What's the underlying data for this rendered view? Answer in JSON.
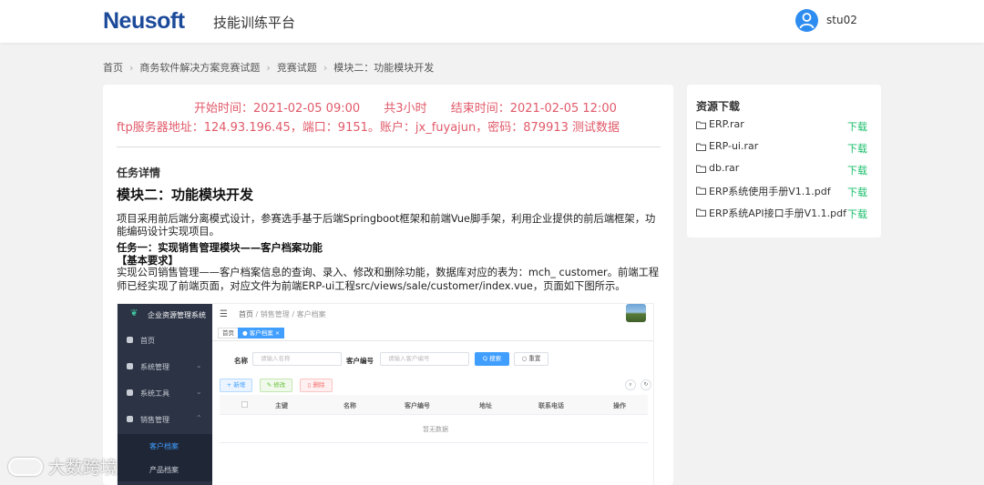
{
  "header": {
    "logo": "Neusoft",
    "platform": "技能训练平台",
    "username": "stu02"
  },
  "breadcrumb": [
    "首页",
    "商务软件解决方案竞赛试题",
    "竞赛试题",
    "模块二：功能模块开发"
  ],
  "exam": {
    "start": "开始时间：2021-02-05 09:00",
    "duration": "共3小时",
    "end": "结束时间：2021-02-05 12:00",
    "ftp": "ftp服务器地址：124.93.196.45，端口：9151。账户：jx_fuyajun，密码：879913 测试数据"
  },
  "task": {
    "section_title": "任务详情",
    "module_title": "模块二：功能模块开发",
    "description": "项目采用前后端分离模式设计，参赛选手基于后端Springboot框架和前端Vue脚手架，利用企业提供的前后端框架，功能编码设计实现项目。",
    "task_title": "任务一：实现销售管理模块——客户档案功能",
    "req_title": "【基本要求】",
    "req_text": "实现公司销售管理——客户档案信息的查询、录入、修改和删除功能，数据库对应的表为：mch_ customer。前端工程师已经实现了前端页面，对应文件为前端ERP-ui工程src/views/sale/customer/index.vue，页面如下图所示。"
  },
  "screenshot": {
    "system_name": "企业资源管理系统",
    "menu": [
      "首页",
      "系统管理",
      "系统工具",
      "销售管理"
    ],
    "submenu": [
      "客户档案",
      "产品档案"
    ],
    "crumb_home": "首页",
    "crumb_rest": "/ 销售管理 / 客户档案",
    "tabs": [
      "首页",
      "● 客户档案 ×"
    ],
    "label_name": "名称",
    "placeholder_name": "请输入名称",
    "label_code": "客户编号",
    "placeholder_code": "请输入客户编号",
    "btn_search": "Q 搜索",
    "btn_reset": "○ 重置",
    "btn_add": "+ 新增",
    "btn_edit": "✎ 修改",
    "btn_delete": "▯ 删除",
    "columns": [
      "主键",
      "名称",
      "客户编号",
      "地址",
      "联系电话",
      "操作"
    ],
    "empty_text": "暂无数据"
  },
  "resources": {
    "title": "资源下载",
    "download_label": "下载",
    "files": [
      "ERP.rar",
      "ERP-ui.rar",
      "db.rar",
      "ERP系统使用手册V1.1.pdf",
      "ERP系统API接口手册V1.1.pdf"
    ]
  },
  "watermark": "大数跨境",
  "colors": {
    "brand": "#1c4a9a",
    "alert": "#e15a6a",
    "download": "#19be6b",
    "accent": "#409eff"
  }
}
